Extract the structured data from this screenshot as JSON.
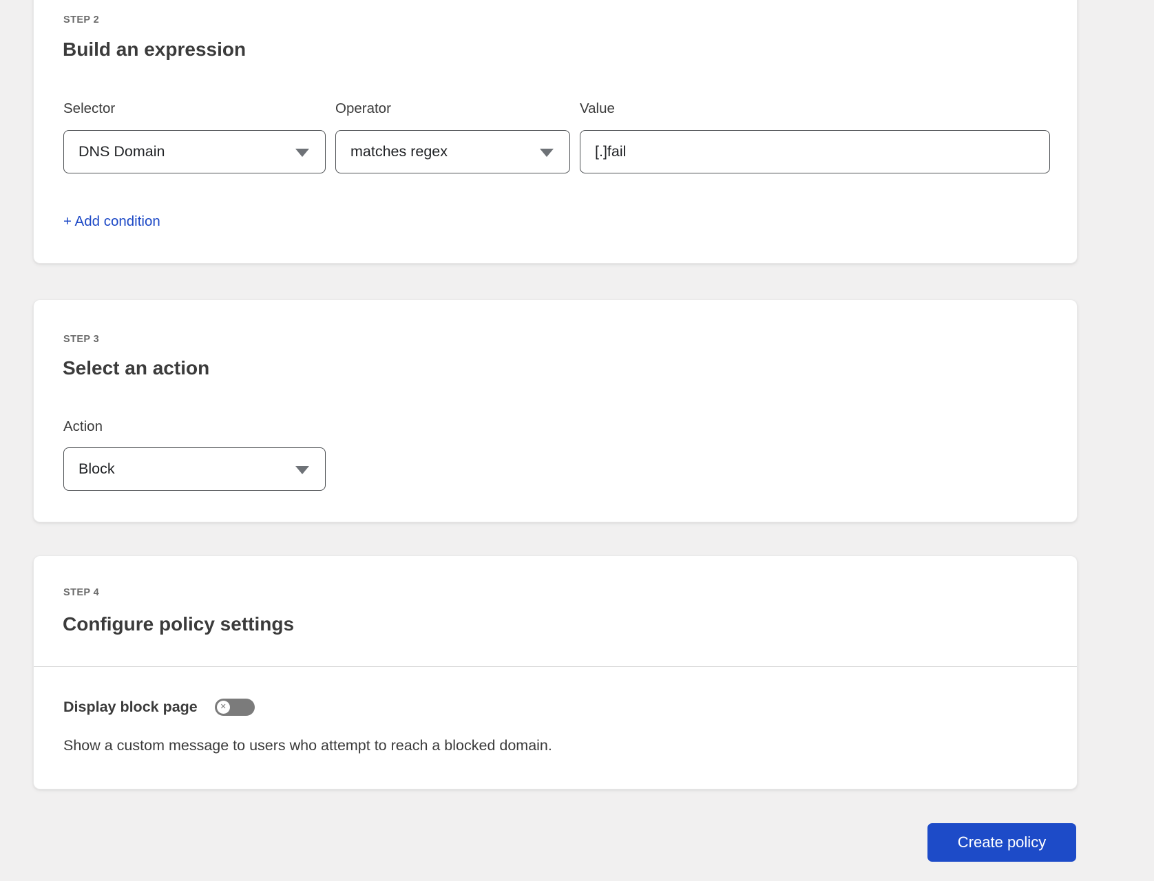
{
  "colors": {
    "accent_blue": "#1d4bc8",
    "link_blue": "#1d49c6",
    "toggle_off_gray": "#7b7b7b",
    "page_background": "#f1f0f0"
  },
  "step2": {
    "step_label": "STEP 2",
    "title": "Build an expression",
    "fields": {
      "selector": {
        "label": "Selector",
        "value": "DNS Domain"
      },
      "operator": {
        "label": "Operator",
        "value": "matches regex"
      },
      "value": {
        "label": "Value",
        "value": "[.]fail"
      }
    },
    "add_condition_label": "+ Add condition"
  },
  "step3": {
    "step_label": "STEP 3",
    "title": "Select an action",
    "action": {
      "label": "Action",
      "value": "Block"
    }
  },
  "step4": {
    "step_label": "STEP 4",
    "title": "Configure policy settings",
    "display_block_page": {
      "label": "Display block page",
      "toggle_state": "off",
      "toggle_icon": "✕",
      "description": "Show a custom message to users who attempt to reach a blocked domain."
    }
  },
  "footer": {
    "create_policy_label": "Create policy"
  }
}
